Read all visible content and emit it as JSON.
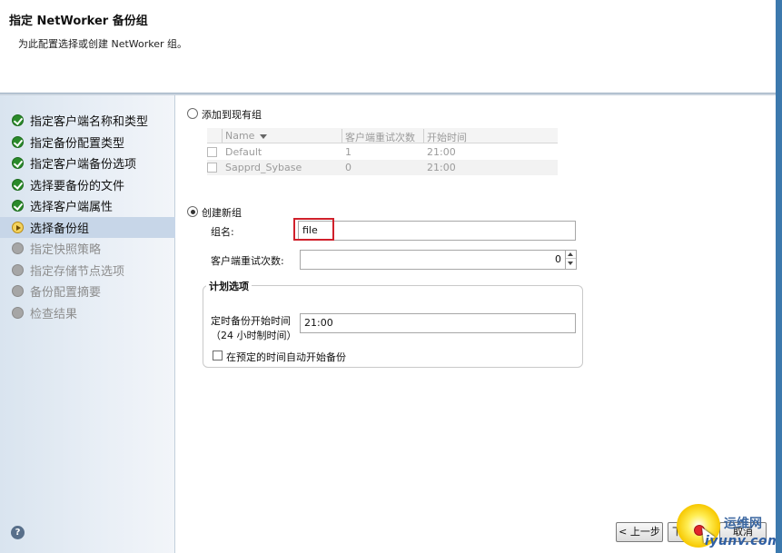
{
  "header": {
    "title": "指定 NetWorker 备份组",
    "subtitle": "为此配置选择或创建 NetWorker 组。"
  },
  "sidebar": {
    "steps": [
      {
        "label": "指定客户端名称和类型",
        "state": "done"
      },
      {
        "label": "指定备份配置类型",
        "state": "done"
      },
      {
        "label": "指定客户端备份选项",
        "state": "done"
      },
      {
        "label": "选择要备份的文件",
        "state": "done"
      },
      {
        "label": "选择客户端属性",
        "state": "done"
      },
      {
        "label": "选择备份组",
        "state": "current"
      },
      {
        "label": "指定快照策略",
        "state": "pending"
      },
      {
        "label": "指定存储节点选项",
        "state": "pending"
      },
      {
        "label": "备份配置摘要",
        "state": "pending"
      },
      {
        "label": "检查结果",
        "state": "pending"
      }
    ],
    "help_icon": "?"
  },
  "existing_group": {
    "radio_label": "添加到现有组",
    "selected": false,
    "table": {
      "headers": [
        "Name",
        "客户端重试次数",
        "开始时间"
      ],
      "rows": [
        {
          "name": "Default",
          "retries": "1",
          "start": "21:00"
        },
        {
          "name": "Sapprd_Sybase",
          "retries": "0",
          "start": "21:00"
        }
      ]
    }
  },
  "new_group": {
    "radio_label": "创建新组",
    "selected": true,
    "group_name_label": "组名:",
    "group_name_value": "file",
    "retries_label": "客户端重试次数:",
    "retries_value": "0",
    "schedule": {
      "legend": "计划选项",
      "start_time_label_line1": "定时备份开始时间",
      "start_time_label_line2": "（24 小时制时间）",
      "start_time_value": "21:00",
      "auto_start_label": "在预定的时间自动开始备份",
      "auto_start_checked": false
    }
  },
  "footer": {
    "back_label": "< 上一步",
    "next_label": "下一步",
    "cancel_label": "取消"
  },
  "watermark": {
    "line1": "运维网",
    "line2": "iyunv.com"
  },
  "colors": {
    "highlight": "#d0202b",
    "done_icon": "#2a8a2a",
    "current_icon": "#f4d35e",
    "sidebar_bg": "#d9e4ef"
  }
}
